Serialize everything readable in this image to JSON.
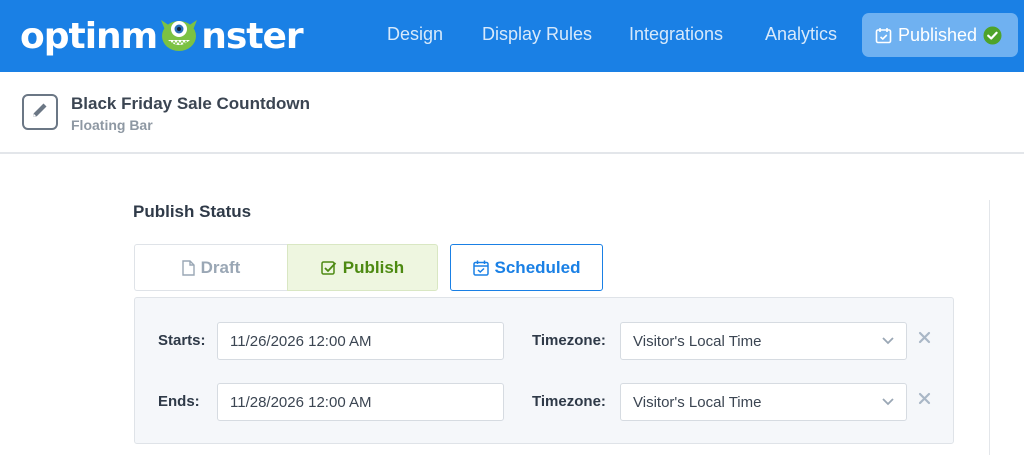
{
  "brand": {
    "logo_left": "optinm",
    "logo_right": "nster",
    "primary_color": "#1a80e5",
    "success_color": "#4d8a12"
  },
  "nav": {
    "items": [
      {
        "label": "Design"
      },
      {
        "label": "Display Rules"
      },
      {
        "label": "Integrations"
      },
      {
        "label": "Analytics"
      }
    ],
    "status_button": {
      "label": "Published",
      "icon": "calendar-check-icon",
      "badge_icon": "check-circle-icon"
    }
  },
  "campaign": {
    "title": "Black Friday Sale Countdown",
    "type": "Floating Bar",
    "edit_icon": "pencil-icon"
  },
  "publish_status": {
    "title": "Publish Status",
    "options": [
      {
        "label": "Draft",
        "icon": "file-icon",
        "state": "inactive"
      },
      {
        "label": "Publish",
        "icon": "checkbox-icon",
        "state": "selected"
      },
      {
        "label": "Scheduled",
        "icon": "calendar-icon",
        "state": "active"
      }
    ]
  },
  "schedule": {
    "rows": [
      {
        "label": "Starts:",
        "value": "11/26/2026 12:00 AM",
        "timezone_label": "Timezone:",
        "timezone_value": "Visitor's Local Time"
      },
      {
        "label": "Ends:",
        "value": "11/28/2026 12:00 AM",
        "timezone_label": "Timezone:",
        "timezone_value": "Visitor's Local Time"
      }
    ]
  }
}
